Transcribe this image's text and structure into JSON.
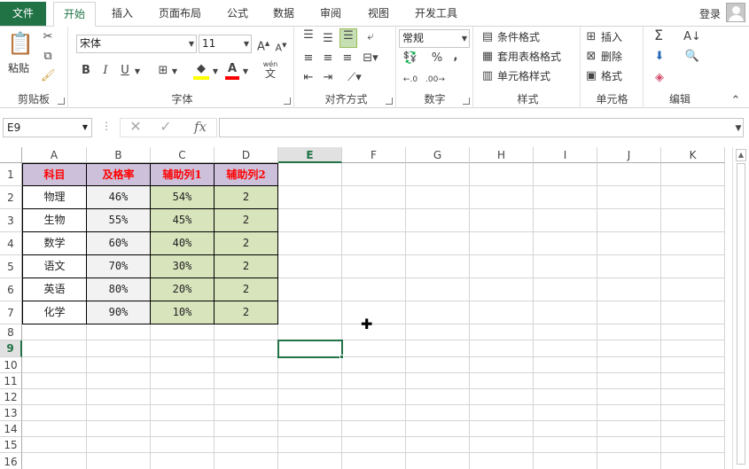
{
  "tabs": {
    "file": "文件",
    "items": [
      "开始",
      "插入",
      "页面布局",
      "公式",
      "数据",
      "审阅",
      "视图",
      "开发工具"
    ],
    "active": "开始",
    "login": "登录"
  },
  "ribbon": {
    "clipboard": {
      "paste": "粘贴",
      "label": "剪贴板"
    },
    "font": {
      "name": "宋体",
      "size": "11",
      "bold": "B",
      "italic": "I",
      "underline": "U",
      "label": "字体",
      "phonetic": "wén",
      "phonetic_char": "文"
    },
    "alignment": {
      "label": "对齐方式"
    },
    "number": {
      "format": "常规",
      "percent": "%",
      "comma": ",",
      "label": "数字"
    },
    "styles": {
      "conditional": "条件格式",
      "table": "套用表格格式",
      "cell": "单元格样式",
      "label": "样式"
    },
    "cells": {
      "insert": "插入",
      "delete": "删除",
      "format": "格式",
      "label": "单元格"
    },
    "editing": {
      "label": "编辑"
    }
  },
  "formula_bar": {
    "name_box": "E9",
    "fx": "fx",
    "value": ""
  },
  "columns": [
    "A",
    "B",
    "C",
    "D",
    "E",
    "F",
    "G",
    "H",
    "I",
    "J",
    "K"
  ],
  "selected_column": "E",
  "rows": [
    "1",
    "2",
    "3",
    "4",
    "5",
    "6",
    "7",
    "8",
    "9",
    "10",
    "11",
    "12",
    "13",
    "14",
    "15",
    "16"
  ],
  "selected_row": "9",
  "table": {
    "headers": [
      "科目",
      "及格率",
      "辅助列1",
      "辅助列2"
    ],
    "rows": [
      [
        "物理",
        "46%",
        "54%",
        "2"
      ],
      [
        "生物",
        "55%",
        "45%",
        "2"
      ],
      [
        "数学",
        "60%",
        "40%",
        "2"
      ],
      [
        "语文",
        "70%",
        "30%",
        "2"
      ],
      [
        "英语",
        "80%",
        "20%",
        "2"
      ],
      [
        "化学",
        "90%",
        "10%",
        "2"
      ]
    ]
  },
  "colors": {
    "accent": "#217346",
    "header_bg": "#ccc0da",
    "header_text": "#ff0000",
    "aux_bg": "#d8e4bc",
    "rate_bg": "#f2f2f2"
  }
}
